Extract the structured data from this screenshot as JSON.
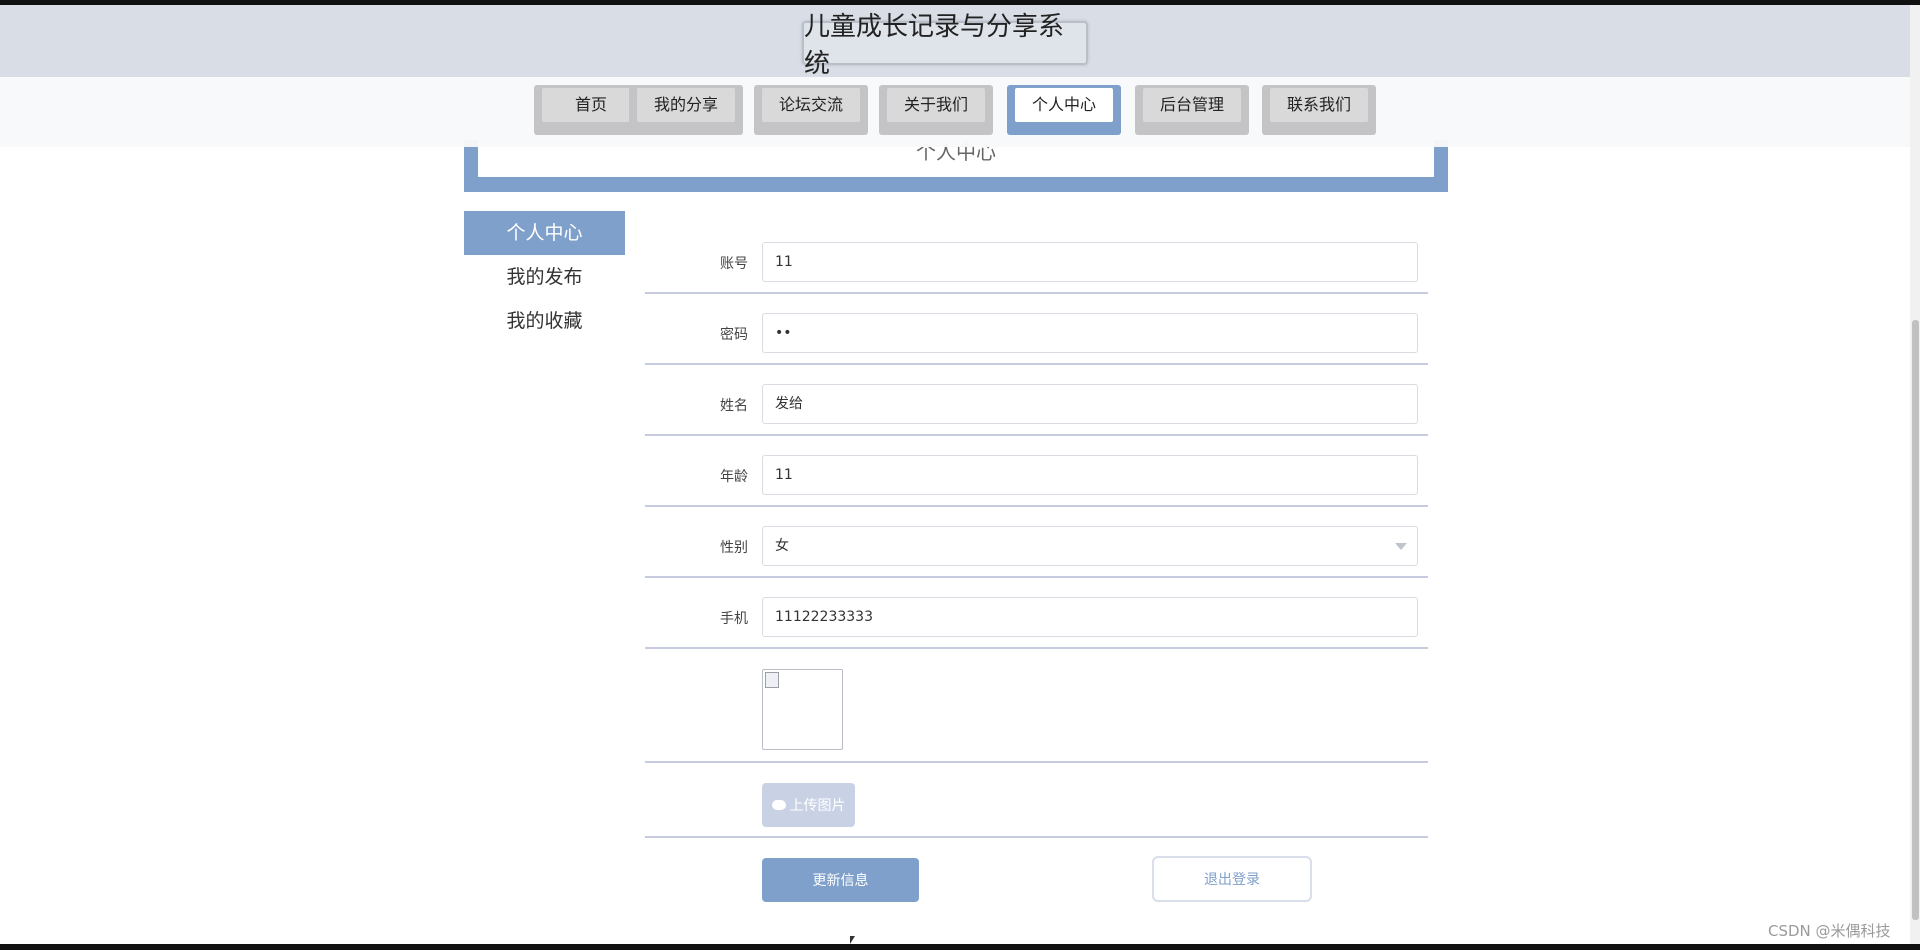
{
  "header": {
    "title": "儿童成长记录与分享系统"
  },
  "nav": {
    "items": [
      {
        "label": "首页"
      },
      {
        "label": "我的分享"
      },
      {
        "label": "论坛交流"
      },
      {
        "label": "关于我们"
      },
      {
        "label": "个人中心",
        "active": true
      },
      {
        "label": "后台管理"
      },
      {
        "label": "联系我们"
      }
    ]
  },
  "banner": {
    "title": "个人中心"
  },
  "sidebar": {
    "items": [
      {
        "label": "个人中心",
        "active": true
      },
      {
        "label": "我的发布"
      },
      {
        "label": "我的收藏"
      }
    ]
  },
  "form": {
    "account": {
      "label": "账号",
      "value": "11"
    },
    "password": {
      "label": "密码",
      "value": "••"
    },
    "name": {
      "label": "姓名",
      "value": "发给"
    },
    "age": {
      "label": "年龄",
      "value": "11"
    },
    "gender": {
      "label": "性别",
      "value": "女"
    },
    "phone": {
      "label": "手机",
      "value": "11122233333"
    },
    "upload_label": "上传图片",
    "update_button": "更新信息",
    "logout_button": "退出登录"
  },
  "watermark": "CSDN @米偶科技",
  "colors": {
    "accent": "#7fa0cb",
    "header_bg": "#d8dde6"
  }
}
